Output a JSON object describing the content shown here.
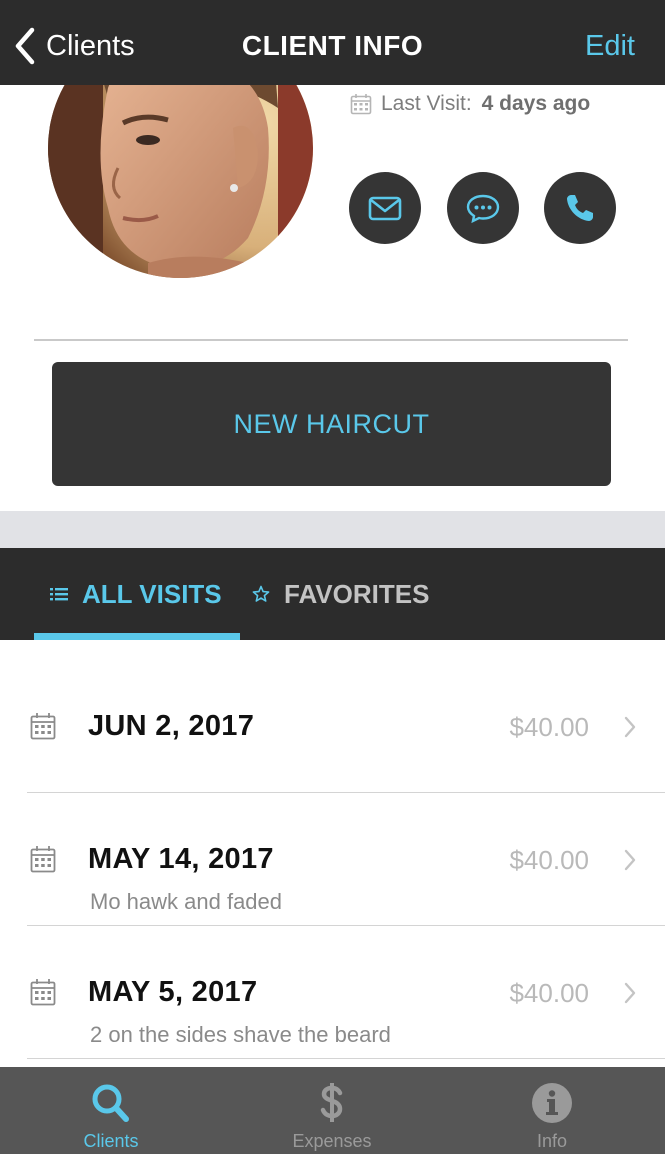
{
  "navbar": {
    "back_label": "Clients",
    "title": "CLIENT INFO",
    "edit_label": "Edit"
  },
  "profile": {
    "last_visit_label": "Last Visit:",
    "last_visit_value": "4 days ago",
    "contact_buttons": [
      "envelope-icon",
      "chat-bubble-icon",
      "phone-icon"
    ]
  },
  "actions": {
    "new_haircut_label": "NEW HAIRCUT"
  },
  "tabs": {
    "all_visits": "ALL VISITS",
    "favorites": "FAVORITES",
    "active": "ALL VISITS"
  },
  "visits": [
    {
      "date": "JUN 2, 2017",
      "price": "$40.00",
      "note": ""
    },
    {
      "date": "MAY 14, 2017",
      "price": "$40.00",
      "note": "Mo hawk and faded"
    },
    {
      "date": "MAY 5, 2017",
      "price": "$40.00",
      "note": "2 on the sides shave the beard"
    }
  ],
  "tabbar": {
    "items": [
      {
        "label": "Clients",
        "icon": "search-icon",
        "active": true
      },
      {
        "label": "Expenses",
        "icon": "dollar-icon",
        "active": false
      },
      {
        "label": "Info",
        "icon": "info-icon",
        "active": false
      }
    ]
  },
  "colors": {
    "accent": "#5ac8ea",
    "dark": "#2c2c2c",
    "button_dark": "#353535",
    "tabbar_bg": "#565656"
  }
}
